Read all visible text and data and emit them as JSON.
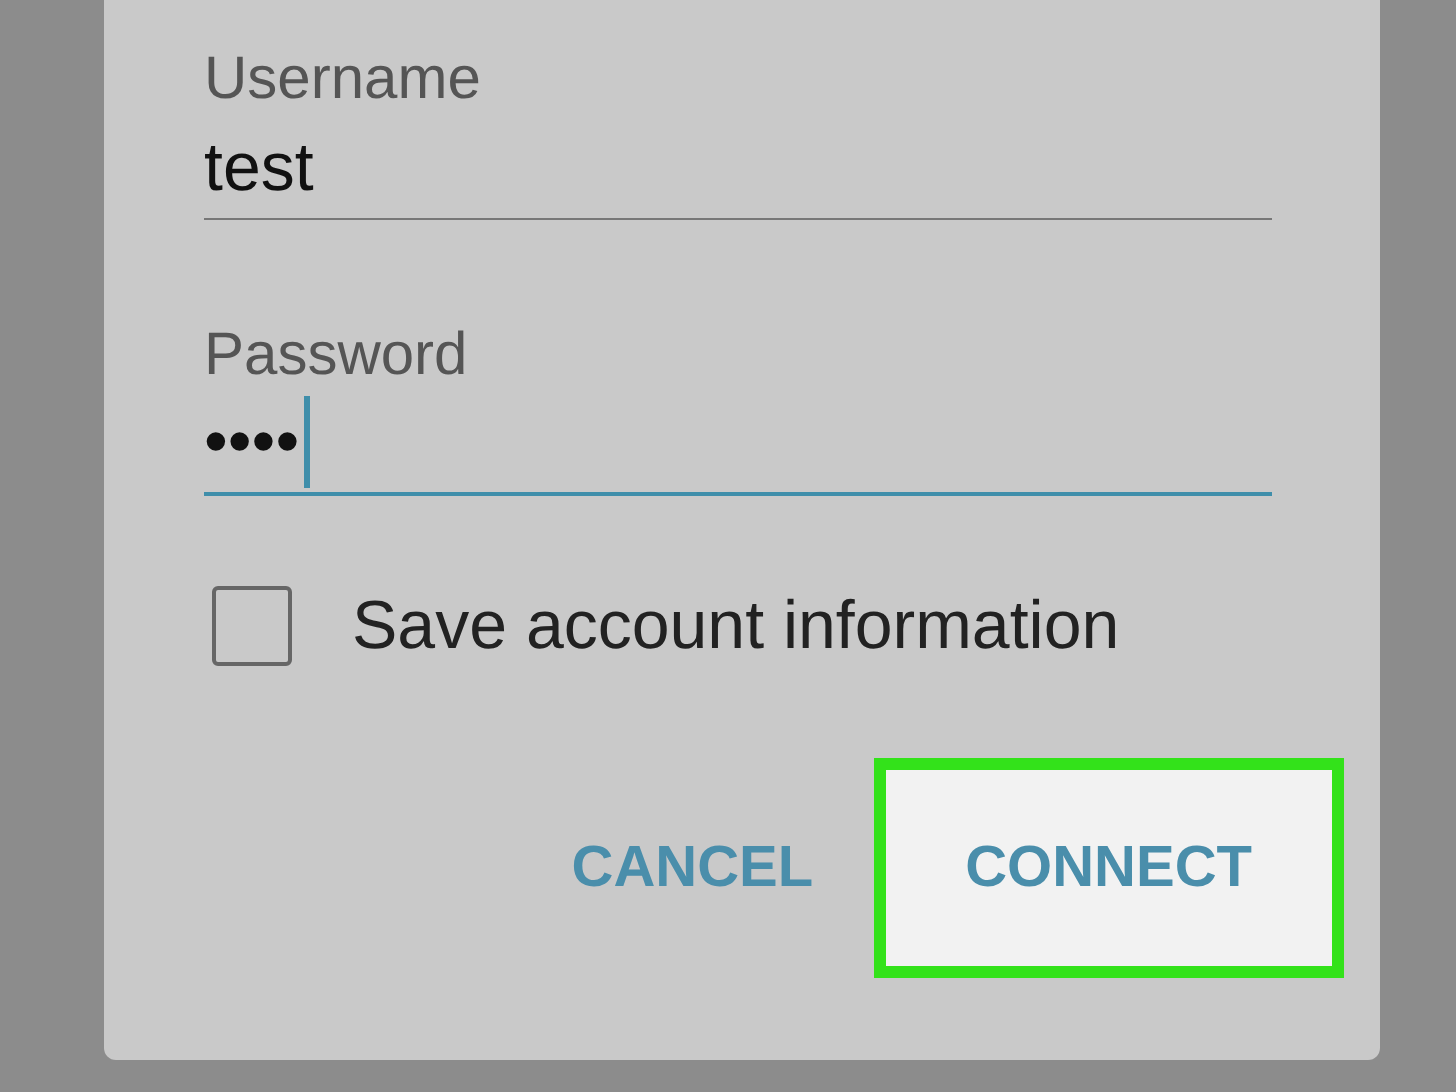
{
  "fields": [
    {
      "label": "Username",
      "value": "test",
      "focused": false
    },
    {
      "label": "Password",
      "value": "••••",
      "focused": true
    }
  ],
  "checkbox": {
    "label": "Save account information",
    "checked": false
  },
  "buttons": [
    {
      "label": "CANCEL",
      "highlighted": false
    },
    {
      "label": "CONNECT",
      "highlighted": true
    }
  ]
}
